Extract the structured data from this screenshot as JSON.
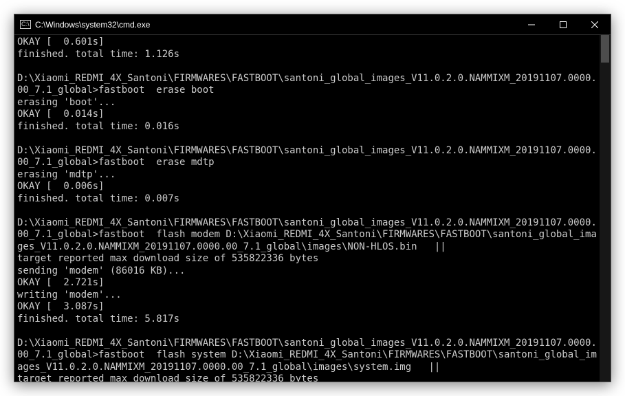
{
  "window": {
    "title": "C:\\Windows\\system32\\cmd.exe"
  },
  "terminal": {
    "lines": [
      "OKAY [  0.601s]",
      "finished. total time: 1.126s",
      "",
      "D:\\Xiaomi_REDMI_4X_Santoni\\FIRMWARES\\FASTBOOT\\santoni_global_images_V11.0.2.0.NAMMIXM_20191107.0000.00_7.1_global>fastboot  erase boot",
      "erasing 'boot'...",
      "OKAY [  0.014s]",
      "finished. total time: 0.016s",
      "",
      "D:\\Xiaomi_REDMI_4X_Santoni\\FIRMWARES\\FASTBOOT\\santoni_global_images_V11.0.2.0.NAMMIXM_20191107.0000.00_7.1_global>fastboot  erase mdtp",
      "erasing 'mdtp'...",
      "OKAY [  0.006s]",
      "finished. total time: 0.007s",
      "",
      "D:\\Xiaomi_REDMI_4X_Santoni\\FIRMWARES\\FASTBOOT\\santoni_global_images_V11.0.2.0.NAMMIXM_20191107.0000.00_7.1_global>fastboot  flash modem D:\\Xiaomi_REDMI_4X_Santoni\\FIRMWARES\\FASTBOOT\\santoni_global_images_V11.0.2.0.NAMMIXM_20191107.0000.00_7.1_global\\images\\NON-HLOS.bin   ||",
      "target reported max download size of 535822336 bytes",
      "sending 'modem' (86016 KB)...",
      "OKAY [  2.721s]",
      "writing 'modem'...",
      "OKAY [  3.087s]",
      "finished. total time: 5.817s",
      "",
      "D:\\Xiaomi_REDMI_4X_Santoni\\FIRMWARES\\FASTBOOT\\santoni_global_images_V11.0.2.0.NAMMIXM_20191107.0000.00_7.1_global>fastboot  flash system D:\\Xiaomi_REDMI_4X_Santoni\\FIRMWARES\\FASTBOOT\\santoni_global_images_V11.0.2.0.NAMMIXM_20191107.0000.00_7.1_global\\images\\system.img   ||",
      "target reported max download size of 535822336 bytes"
    ]
  }
}
